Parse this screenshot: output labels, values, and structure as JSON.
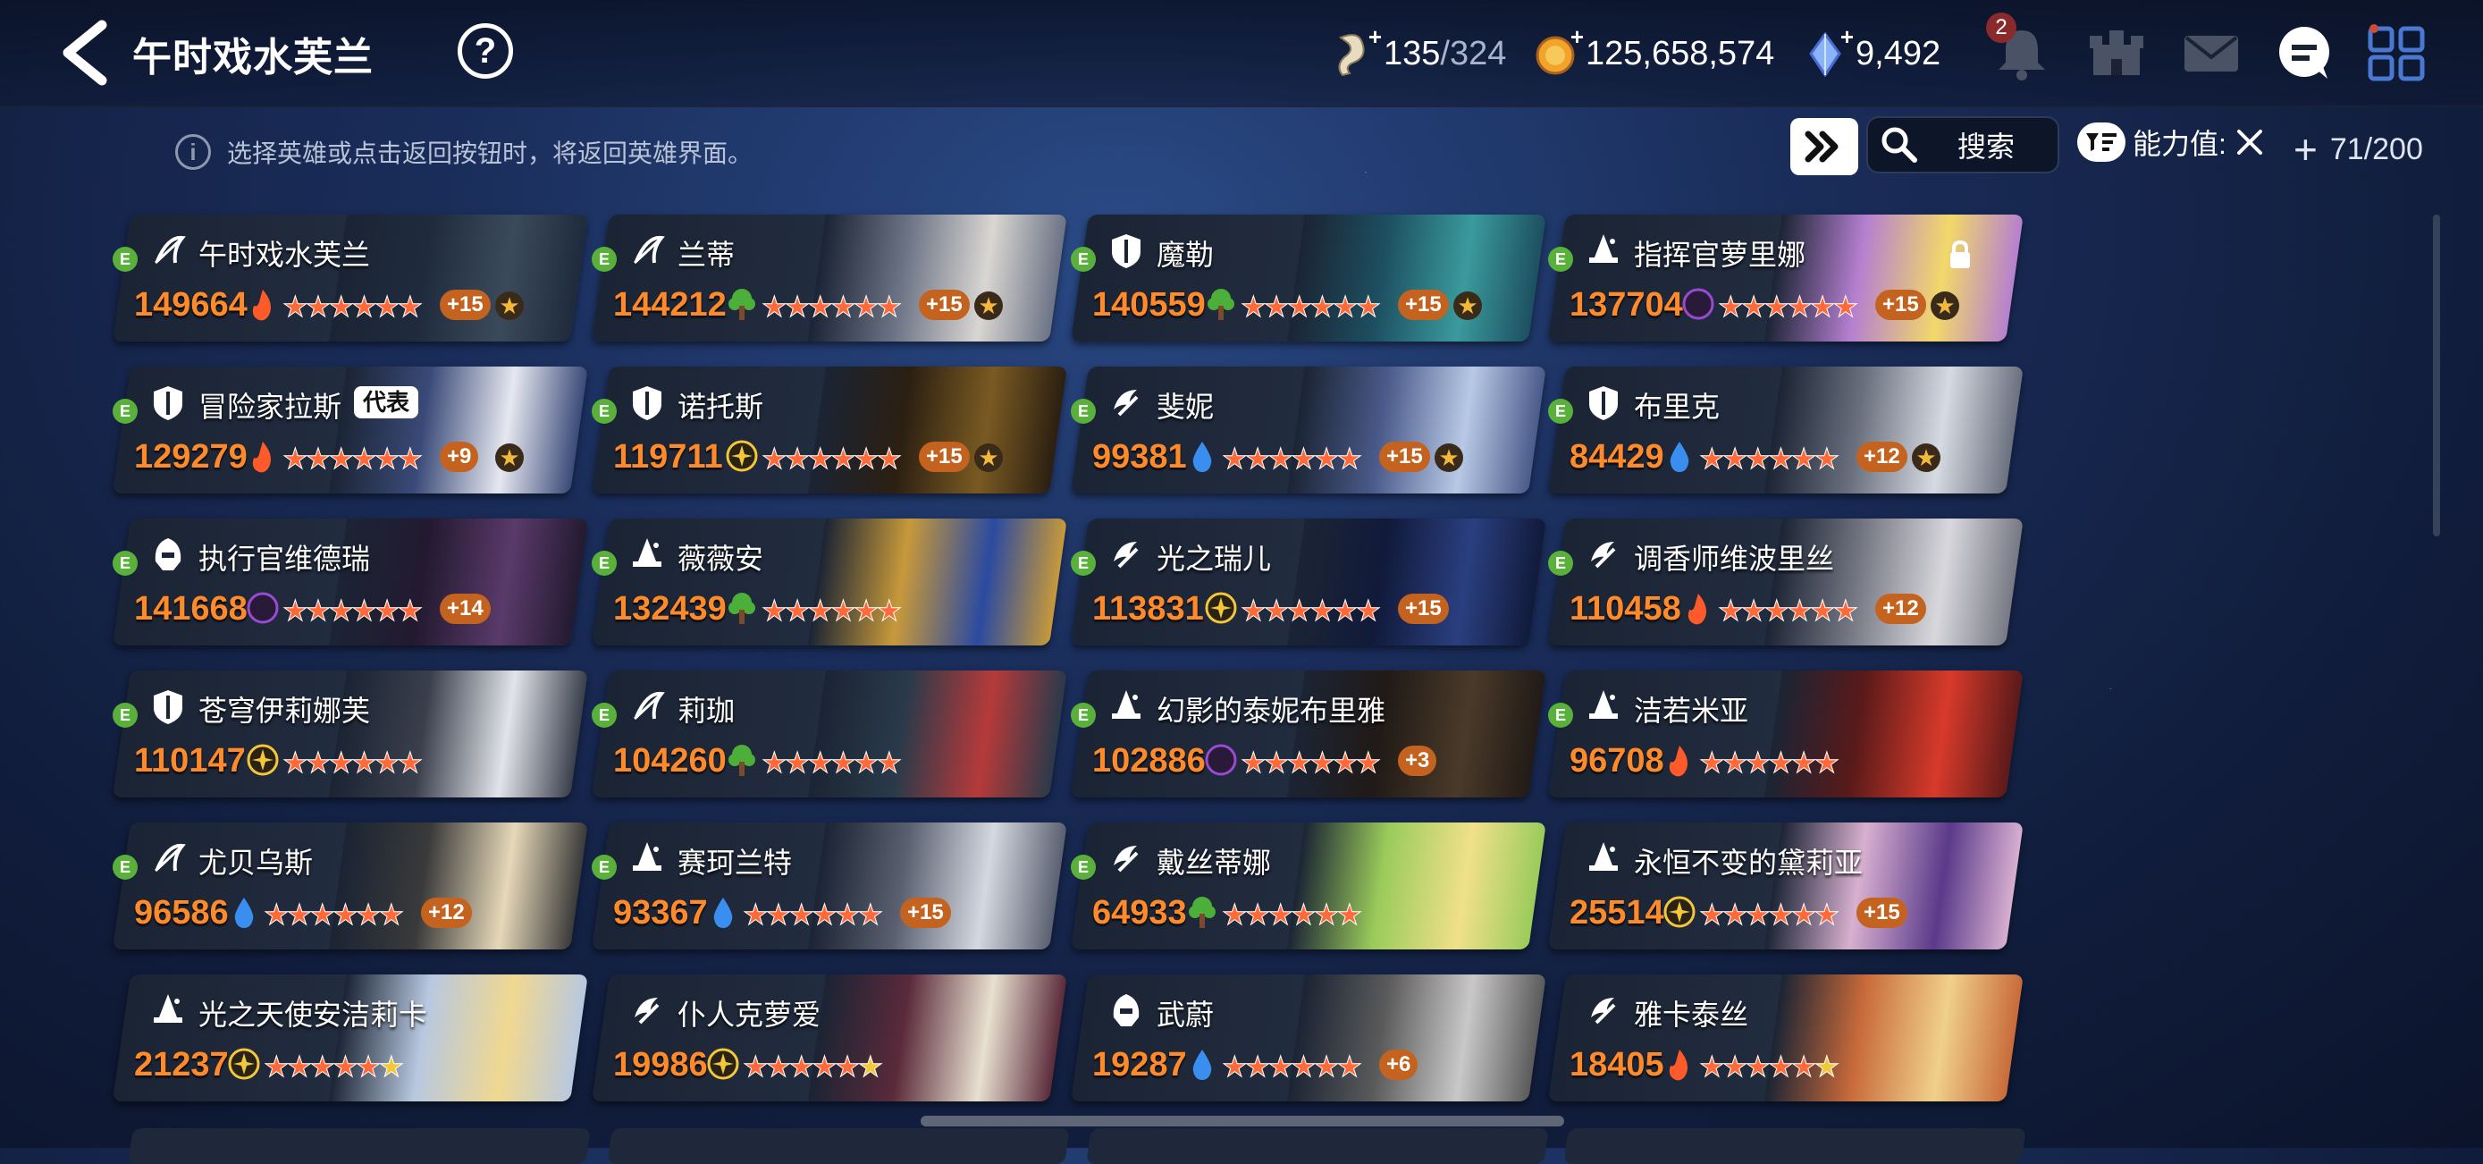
{
  "header": {
    "title": "午时戏水芙兰",
    "help": "?",
    "resources": [
      {
        "icon": "stamina-icon",
        "value": "135",
        "max": "/324"
      },
      {
        "icon": "gold-icon",
        "value": "125,658,574",
        "max": ""
      },
      {
        "icon": "crystal-icon",
        "value": "9,492",
        "max": ""
      }
    ],
    "notification_count": "2"
  },
  "toolbar": {
    "hint": "选择英雄或点击返回按钮时，将返回英雄界面。",
    "search_label": "搜索",
    "filter_label": "能力值:",
    "hero_count": "71/200"
  },
  "heroes": [
    {
      "name": "午时戏水芙兰",
      "power": "149664",
      "element": "fire",
      "stars": 6,
      "plus": "+15",
      "rank": true,
      "class": "archer",
      "colors": [
        "#3b4a5a",
        "#1f2b3d"
      ]
    },
    {
      "name": "兰蒂",
      "power": "144212",
      "element": "earth",
      "stars": 6,
      "plus": "+15",
      "rank": true,
      "class": "archer",
      "colors": [
        "#d9d6d2",
        "#6b7385"
      ]
    },
    {
      "name": "魔勒",
      "power": "140559",
      "element": "earth",
      "stars": 6,
      "plus": "+15",
      "rank": true,
      "class": "warrior",
      "colors": [
        "#3a9a9c",
        "#1d4f60"
      ]
    },
    {
      "name": "指挥官萝里娜",
      "power": "137704",
      "element": "dark",
      "stars": 6,
      "plus": "+15",
      "rank": true,
      "class": "mage",
      "colors": [
        "#f2d86a",
        "#b57fd0"
      ],
      "locked": true
    },
    {
      "name": "冒险家拉斯",
      "power": "129279",
      "element": "fire",
      "stars": 6,
      "plus": "+9",
      "rank": true,
      "class": "warrior",
      "colors": [
        "#e6e8f0",
        "#3a4a78"
      ],
      "rep": "代表"
    },
    {
      "name": "诺托斯",
      "power": "119711",
      "element": "light",
      "stars": 6,
      "plus": "+15",
      "rank": true,
      "class": "warrior",
      "colors": [
        "#7a5a22",
        "#2b1f12"
      ]
    },
    {
      "name": "斐妮",
      "power": "99381",
      "element": "water",
      "stars": 6,
      "plus": "+15",
      "rank": true,
      "class": "thief",
      "colors": [
        "#b8c9e6",
        "#4a5a8a"
      ]
    },
    {
      "name": "布里克",
      "power": "84429",
      "element": "water",
      "stars": 6,
      "plus": "+12",
      "rank": true,
      "class": "warrior",
      "colors": [
        "#d6dae2",
        "#6a707e"
      ]
    },
    {
      "name": "执行官维德瑞",
      "power": "141668",
      "element": "dark",
      "stars": 6,
      "plus": "+14",
      "rank": false,
      "class": "assassin",
      "colors": [
        "#5a3a6a",
        "#231a30"
      ]
    },
    {
      "name": "薇薇安",
      "power": "132439",
      "element": "earth",
      "stars": 6,
      "plus": "",
      "rank": false,
      "class": "mage",
      "colors": [
        "#2b4aa0",
        "#c7993a"
      ]
    },
    {
      "name": "光之瑞儿",
      "power": "113831",
      "element": "light",
      "stars": 6,
      "plus": "+15",
      "rank": false,
      "class": "thief",
      "colors": [
        "#2a3f80",
        "#111a3a"
      ]
    },
    {
      "name": "调香师维波里丝",
      "power": "110458",
      "element": "fire",
      "stars": 6,
      "plus": "+12",
      "rank": false,
      "class": "thief",
      "colors": [
        "#d8d8dc",
        "#767884"
      ]
    },
    {
      "name": "苍穹伊莉娜芙",
      "power": "110147",
      "element": "light",
      "stars": 6,
      "plus": "",
      "rank": false,
      "class": "warrior",
      "colors": [
        "#e2e4ea",
        "#3a3f4c"
      ]
    },
    {
      "name": "莉珈",
      "power": "104260",
      "element": "earth",
      "stars": 6,
      "plus": "",
      "rank": false,
      "class": "archer",
      "colors": [
        "#b63a3a",
        "#2a3a4a"
      ]
    },
    {
      "name": "幻影的泰妮布里雅",
      "power": "102886",
      "element": "dark",
      "stars": 6,
      "plus": "+3",
      "rank": false,
      "class": "mage",
      "colors": [
        "#4a3a2a",
        "#211a16"
      ]
    },
    {
      "name": "洁若米亚",
      "power": "96708",
      "element": "fire",
      "stars": 6,
      "plus": "",
      "rank": false,
      "class": "mage",
      "colors": [
        "#d83a2a",
        "#5a1a1a"
      ]
    },
    {
      "name": "尤贝乌斯",
      "power": "96586",
      "element": "water",
      "stars": 6,
      "plus": "+12",
      "rank": false,
      "class": "archer",
      "colors": [
        "#e6d8b8",
        "#3a3a3a"
      ]
    },
    {
      "name": "赛珂兰特",
      "power": "93367",
      "element": "water",
      "stars": 6,
      "plus": "+15",
      "rank": false,
      "class": "mage",
      "colors": [
        "#d4d8e0",
        "#5a6070"
      ]
    },
    {
      "name": "戴丝蒂娜",
      "power": "64933",
      "element": "earth",
      "stars": 6,
      "plus": "",
      "rank": false,
      "class": "thief",
      "colors": [
        "#f0e08a",
        "#9acb5a"
      ]
    },
    {
      "name": "永恒不变的黛莉亚",
      "power": "25514",
      "element": "light",
      "stars": 6,
      "plus": "+15",
      "rank": false,
      "class": "mage",
      "colors": [
        "#5a3a8a",
        "#d8b0d0"
      ]
    },
    {
      "name": "光之天使安洁莉卡",
      "power": "21237",
      "element": "light",
      "stars": 5,
      "plus": "",
      "rank": false,
      "class": "mage",
      "colors": [
        "#f0d890",
        "#b8c8e0"
      ]
    },
    {
      "name": "仆人克萝爱",
      "power": "19986",
      "element": "light",
      "stars": 5,
      "plus": "",
      "rank": false,
      "class": "thief",
      "colors": [
        "#e8e0d0",
        "#5a2a3a"
      ]
    },
    {
      "name": "武蔚",
      "power": "19287",
      "element": "water",
      "stars": 6,
      "plus": "+6",
      "rank": false,
      "class": "assassin",
      "colors": [
        "#c8c8c8",
        "#5a5a5a"
      ]
    },
    {
      "name": "雅卡泰丝",
      "power": "18405",
      "element": "fire",
      "stars": 5,
      "plus": "",
      "rank": false,
      "class": "thief",
      "colors": [
        "#f0d08a",
        "#c86a3a"
      ]
    }
  ],
  "colors": {
    "power": "#ff8a2a",
    "badge_e": "#59b03a",
    "plus_badge": "#c4621f",
    "fire": "#ff5a2a",
    "earth": "#4caf3a",
    "water": "#3a8ef0",
    "dark": "#9a4ad0",
    "light": "#f2c83a"
  }
}
